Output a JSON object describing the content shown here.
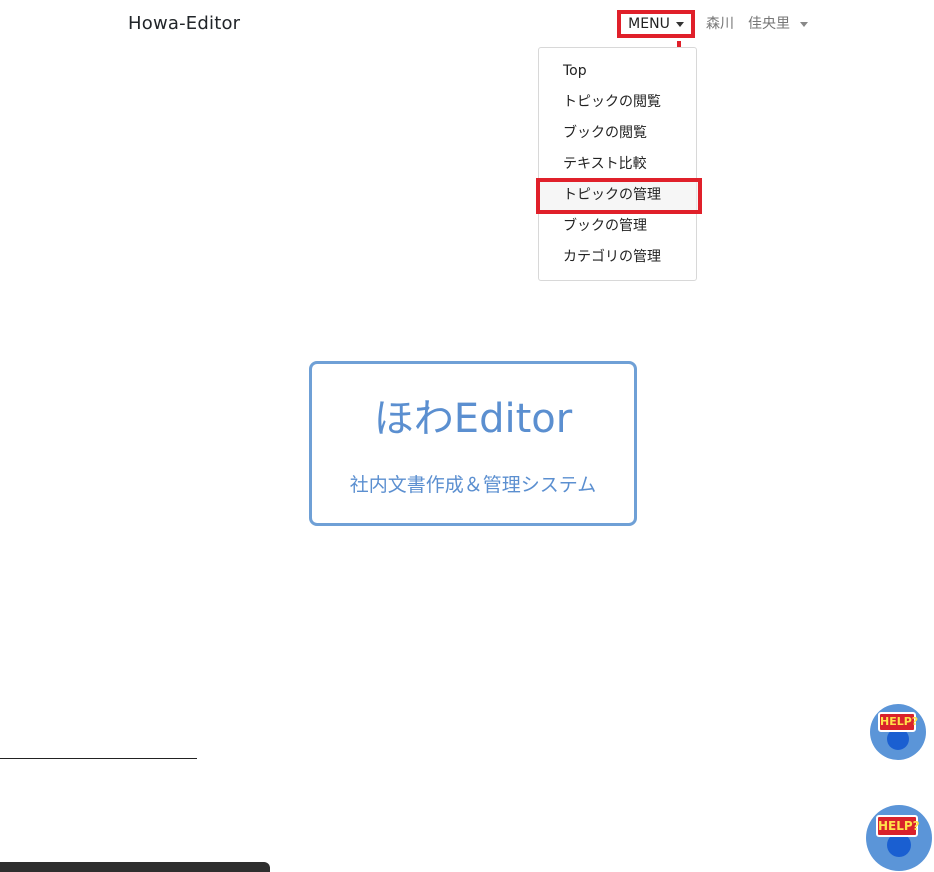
{
  "navbar": {
    "brand": "Howa-Editor",
    "menu_label": "MENU",
    "user": {
      "last_name": "森川",
      "first_name": "佳央里"
    }
  },
  "dropdown": {
    "items": [
      {
        "label": "Top"
      },
      {
        "label": "トピックの閲覧"
      },
      {
        "label": "ブックの閲覧"
      },
      {
        "label": "テキスト比較"
      },
      {
        "label": "トピックの管理"
      },
      {
        "label": "ブックの管理"
      },
      {
        "label": "カテゴリの管理"
      }
    ]
  },
  "hero": {
    "title": "ほわEditor",
    "subtitle": "社内文書作成＆管理システム"
  },
  "help": {
    "label": "HELP?"
  },
  "colors": {
    "accent_red": "#e0202a",
    "hero_blue": "#5b8fd0",
    "help_bg": "#5b95d8"
  }
}
